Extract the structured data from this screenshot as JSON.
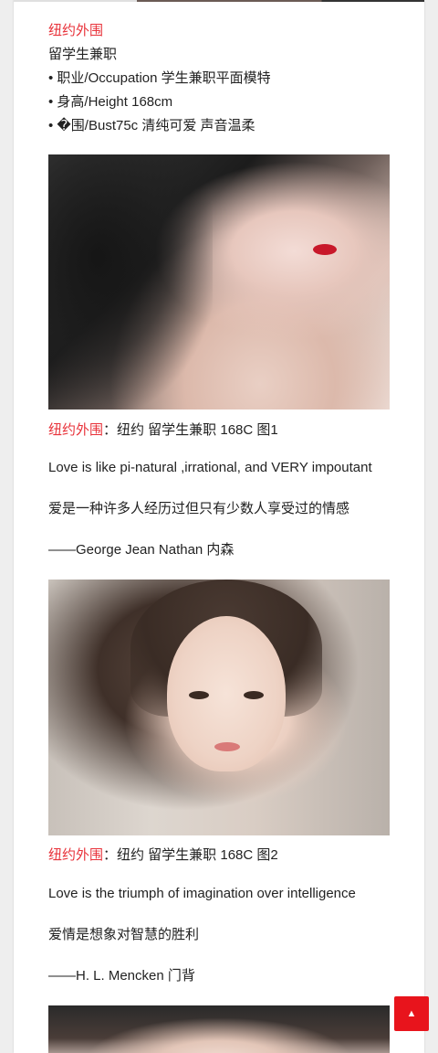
{
  "intro": {
    "tag": "纽约外围",
    "line1": "留学生兼职",
    "line2": "• 职业/Occupation 学生兼职平面模特",
    "line3": "• 身高/Height 168cm",
    "line4": "• �围/Bust75c 清纯可爱 声音温柔"
  },
  "posts": [
    {
      "caption_tag": "纽约外围",
      "caption_text": "：纽约 留学生兼职 168C 图1",
      "quote_en": "Love is like pi-natural ,irrational, and VERY impoutant",
      "quote_zh": "爱是一种许多人经历过但只有少数人享受过的情感",
      "author": "——George Jean Nathan 内森"
    },
    {
      "caption_tag": "纽约外围",
      "caption_text": "：纽约 留学生兼职 168C 图2",
      "quote_en": "Love is the triumph of imagination over intelligence",
      "quote_zh": "爱情是想象对智慧的胜利",
      "author": "——H. L. Mencken 门背"
    }
  ],
  "scroll_top": {
    "icon": "chevron-up-icon",
    "glyph": "▲",
    "color": "#e8141c"
  },
  "colors": {
    "accent": "#e8323a",
    "text": "#222222",
    "background": "#eeeeee"
  }
}
